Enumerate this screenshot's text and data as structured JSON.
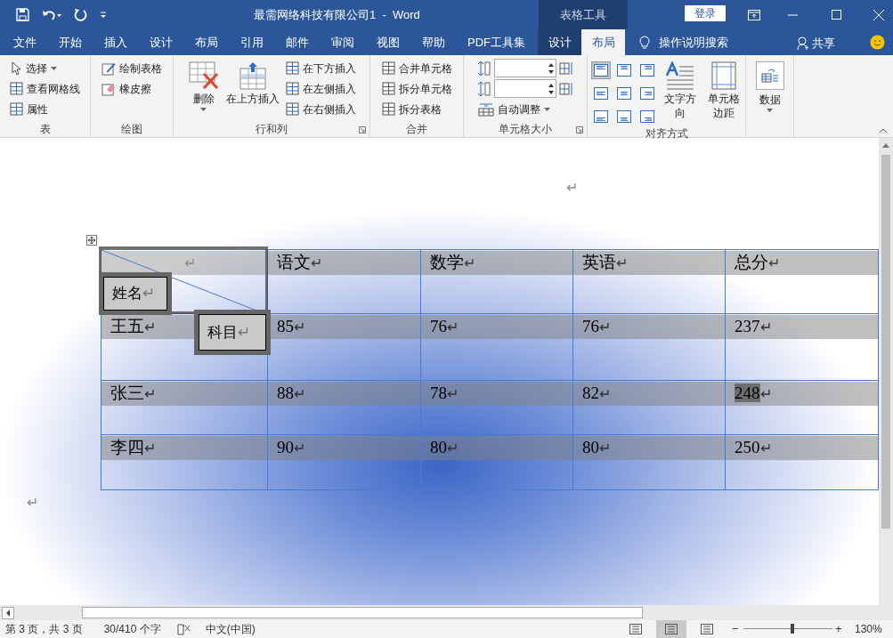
{
  "title_bar": {
    "title": "最需网络科技有限公司1  -  Word",
    "context_label": "表格工具",
    "sign_in": "登录"
  },
  "tabs": [
    {
      "label": "文件",
      "selected": false,
      "contextual": false
    },
    {
      "label": "开始",
      "selected": false,
      "contextual": false
    },
    {
      "label": "插入",
      "selected": false,
      "contextual": false
    },
    {
      "label": "设计",
      "selected": false,
      "contextual": false
    },
    {
      "label": "布局",
      "selected": false,
      "contextual": false
    },
    {
      "label": "引用",
      "selected": false,
      "contextual": false
    },
    {
      "label": "邮件",
      "selected": false,
      "contextual": false
    },
    {
      "label": "审阅",
      "selected": false,
      "contextual": false
    },
    {
      "label": "视图",
      "selected": false,
      "contextual": false
    },
    {
      "label": "帮助",
      "selected": false,
      "contextual": false
    },
    {
      "label": "PDF工具集",
      "selected": false,
      "contextual": false
    },
    {
      "label": "设计",
      "selected": false,
      "contextual": true
    },
    {
      "label": "布局",
      "selected": true,
      "contextual": true
    }
  ],
  "tell_me": "操作说明搜索",
  "share": "共享",
  "ribbon": [
    {
      "label": "表",
      "launcher": false,
      "columns": [
        [
          {
            "kind": "small",
            "label": "选择",
            "dropdown": true
          },
          {
            "kind": "small",
            "label": "查看网格线",
            "dropdown": false
          },
          {
            "kind": "small",
            "label": "属性",
            "dropdown": false
          }
        ]
      ]
    },
    {
      "label": "绘图",
      "launcher": false,
      "columns": [
        [
          {
            "kind": "small",
            "label": "绘制表格",
            "dropdown": false
          },
          {
            "kind": "small",
            "label": "橡皮擦",
            "dropdown": false
          }
        ]
      ]
    },
    {
      "label": "行和列",
      "launcher": true,
      "columns": [
        [
          {
            "kind": "large",
            "label": "删除",
            "dropdown": true
          }
        ],
        [
          {
            "kind": "large",
            "label": "在上方插入",
            "dropdown": false
          }
        ],
        [
          {
            "kind": "small",
            "label": "在下方插入",
            "dropdown": false
          },
          {
            "kind": "small",
            "label": "在左侧插入",
            "dropdown": false
          },
          {
            "kind": "small",
            "label": "在右侧插入",
            "dropdown": false
          }
        ]
      ]
    },
    {
      "label": "合并",
      "launcher": false,
      "columns": [
        [
          {
            "kind": "small",
            "label": "合并单元格",
            "dropdown": false
          },
          {
            "kind": "small",
            "label": "拆分单元格",
            "dropdown": false
          },
          {
            "kind": "small",
            "label": "拆分表格",
            "dropdown": false
          }
        ]
      ]
    },
    {
      "label": "单元格大小",
      "launcher": true,
      "columns": [
        [
          {
            "kind": "spin"
          },
          {
            "kind": "spin"
          },
          {
            "kind": "small",
            "label": "自动调整",
            "dropdown": true
          }
        ]
      ]
    },
    {
      "label": "对齐方式",
      "launcher": false,
      "columns": [
        [
          {
            "kind": "align",
            "buttons": [
              {
                "selected": true
              },
              {
                "selected": false
              },
              {
                "selected": false
              },
              {
                "selected": false
              },
              {
                "selected": false
              },
              {
                "selected": false
              },
              {
                "selected": false
              },
              {
                "selected": false
              },
              {
                "selected": false
              }
            ]
          }
        ],
        [
          {
            "kind": "large",
            "label": "文字方向",
            "dropdown": false
          }
        ],
        [
          {
            "kind": "large",
            "label": "单元格边距",
            "dropdown": false
          }
        ]
      ]
    },
    {
      "launcher": false,
      "columns": [
        [
          {
            "kind": "framed",
            "label": "数据",
            "dropdown": true
          }
        ]
      ]
    }
  ],
  "document": {
    "marks": [
      "↵",
      "↵"
    ],
    "table": {
      "corner": {
        "mark": "↵",
        "name_label": "姓名",
        "name_mark": "↵",
        "subject_label": "科目",
        "subject_mark": "↵"
      },
      "header": [
        {
          "text": "语文",
          "mark": "↵"
        },
        {
          "text": "数学",
          "mark": "↵"
        },
        {
          "text": "英语",
          "mark": "↵"
        },
        {
          "text": "总分",
          "mark": "↵"
        }
      ],
      "rows": [
        {
          "cells": [
            {
              "text": "王五",
              "mark": "↵",
              "selected": false
            },
            {
              "text": "85",
              "mark": "↵",
              "selected": false
            },
            {
              "text": "76",
              "mark": "↵",
              "selected": false
            },
            {
              "text": "76",
              "mark": "↵",
              "selected": false
            },
            {
              "text": "237",
              "mark": "↵",
              "selected": false
            }
          ]
        },
        {
          "cells": [
            {
              "text": "张三",
              "mark": "↵",
              "selected": false
            },
            {
              "text": "88",
              "mark": "↵",
              "selected": false
            },
            {
              "text": "78",
              "mark": "↵",
              "selected": false
            },
            {
              "text": "82",
              "mark": "↵",
              "selected": false
            },
            {
              "text": "248",
              "mark": "↵",
              "selected": true
            }
          ]
        },
        {
          "cells": [
            {
              "text": "李四",
              "mark": "↵",
              "selected": false
            },
            {
              "text": "90",
              "mark": "↵",
              "selected": false
            },
            {
              "text": "80",
              "mark": "↵",
              "selected": false
            },
            {
              "text": "80",
              "mark": "↵",
              "selected": false
            },
            {
              "text": "250",
              "mark": "↵",
              "selected": false
            }
          ]
        }
      ]
    }
  },
  "status_bar": {
    "page": "第 3 页，共 3 页",
    "words": "30/410 个字",
    "language": "中文(中国)",
    "views": [
      {
        "selected": false
      },
      {
        "selected": true
      },
      {
        "selected": false
      }
    ],
    "zoom_out": "−",
    "zoom_in": "+",
    "zoom": {
      "level": 0.55
    },
    "zoom_label": "130%"
  }
}
